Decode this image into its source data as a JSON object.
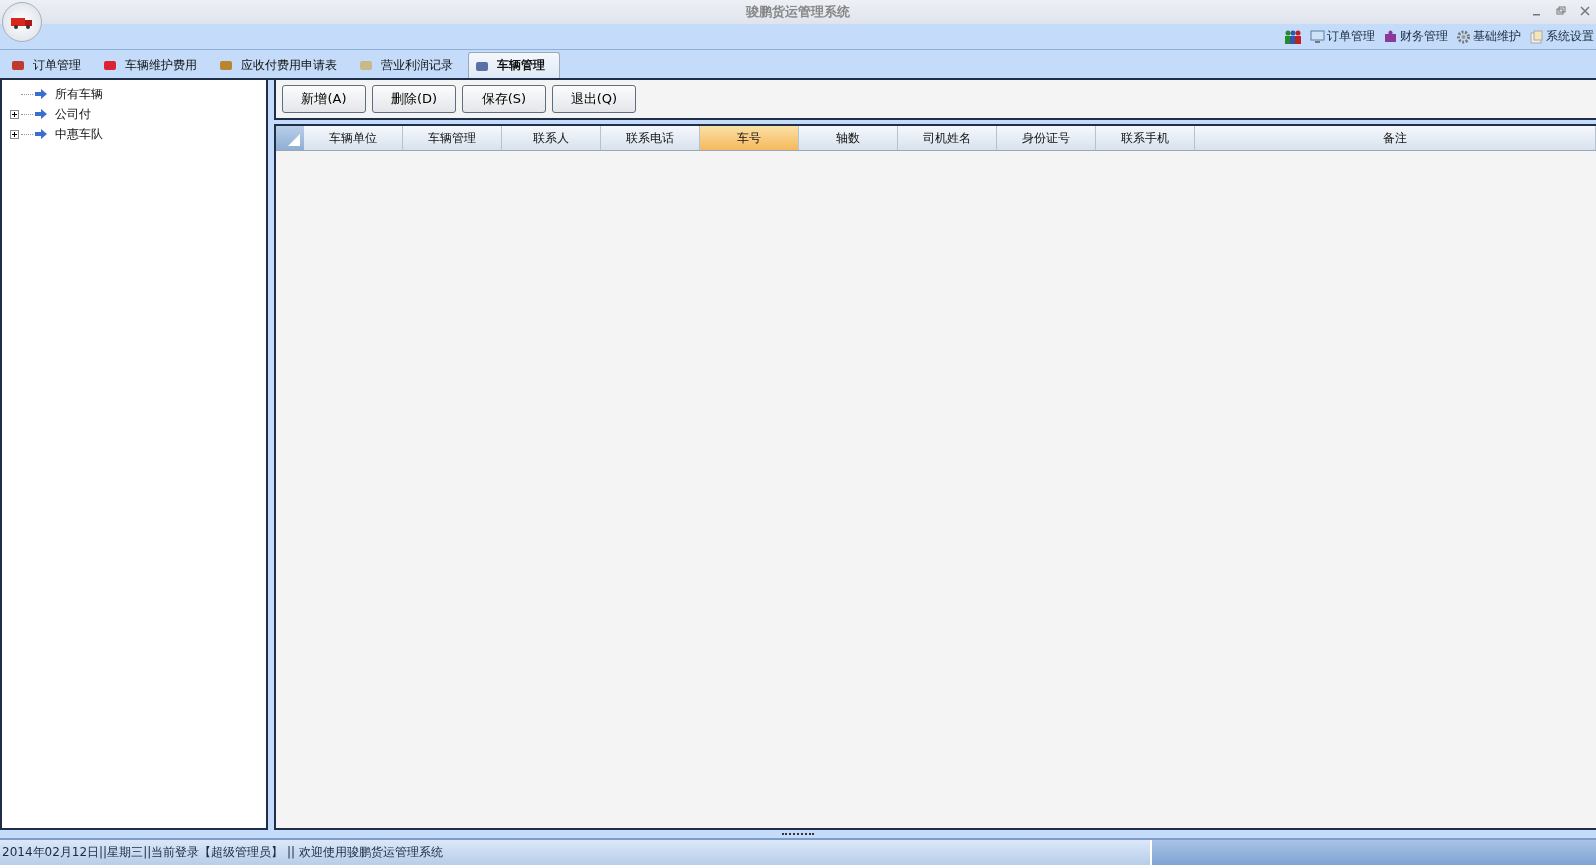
{
  "window": {
    "title": "骏鹏货运管理系统"
  },
  "menu": [
    {
      "label": "订单管理"
    },
    {
      "label": "财务管理"
    },
    {
      "label": "基础维护"
    },
    {
      "label": "系统设置"
    }
  ],
  "tabs": [
    {
      "label": "订单管理",
      "selected": false
    },
    {
      "label": "车辆维护费用",
      "selected": false
    },
    {
      "label": "应收付费用申请表",
      "selected": false
    },
    {
      "label": "营业利润记录",
      "selected": false
    },
    {
      "label": "车辆管理",
      "selected": true
    }
  ],
  "tree": [
    {
      "label": "所有车辆",
      "kind": "leaf"
    },
    {
      "label": "公司付",
      "kind": "group",
      "expanded": false
    },
    {
      "label": "中惠车队",
      "kind": "group",
      "expanded": false
    }
  ],
  "toolbar": [
    "新增(A)",
    "删除(D)",
    "保存(S)",
    "退出(Q)"
  ],
  "table": {
    "columns": [
      {
        "label": "车辆单位",
        "selected": false
      },
      {
        "label": "车辆管理",
        "selected": false
      },
      {
        "label": "联系人",
        "selected": false
      },
      {
        "label": "联系电话",
        "selected": false
      },
      {
        "label": "车号",
        "selected": true
      },
      {
        "label": "轴数",
        "selected": false
      },
      {
        "label": "司机姓名",
        "selected": false
      },
      {
        "label": "身份证号",
        "selected": false
      },
      {
        "label": "联系手机",
        "selected": false
      },
      {
        "label": "备注",
        "selected": false
      }
    ]
  },
  "status_bar": {
    "text": "2014年02月12日||星期三||当前登录【超级管理员】 || 欢迎使用骏鹏货运管理系统"
  }
}
